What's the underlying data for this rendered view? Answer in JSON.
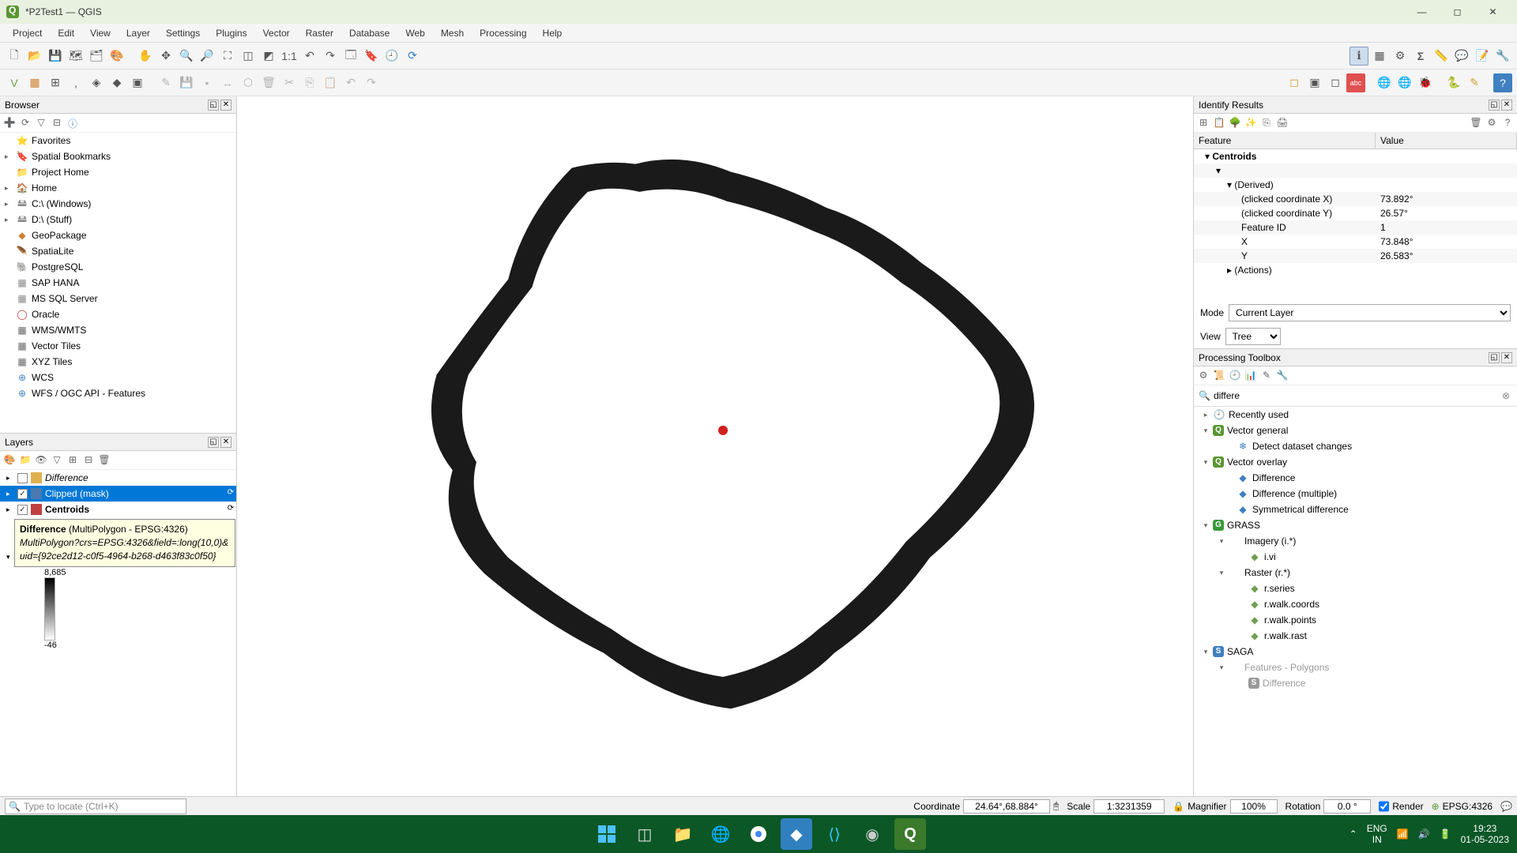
{
  "window": {
    "title": "*P2Test1 — QGIS"
  },
  "menu": [
    "Project",
    "Edit",
    "View",
    "Layer",
    "Settings",
    "Plugins",
    "Vector",
    "Raster",
    "Database",
    "Web",
    "Mesh",
    "Processing",
    "Help"
  ],
  "browser": {
    "title": "Browser",
    "items": [
      {
        "exp": "",
        "icon": "⭐",
        "label": "Favorites",
        "color": "#f0c040"
      },
      {
        "exp": "▸",
        "icon": "🔖",
        "label": "Spatial Bookmarks",
        "color": "#4080c0"
      },
      {
        "exp": "",
        "icon": "📁",
        "label": "Project Home",
        "color": "#888"
      },
      {
        "exp": "▸",
        "icon": "🏠",
        "label": "Home",
        "color": "#888"
      },
      {
        "exp": "▸",
        "icon": "🖴",
        "label": "C:\\ (Windows)",
        "color": "#888"
      },
      {
        "exp": "▸",
        "icon": "🖴",
        "label": "D:\\ (Stuff)",
        "color": "#888"
      },
      {
        "exp": "",
        "icon": "◆",
        "label": "GeoPackage",
        "color": "#d08030"
      },
      {
        "exp": "",
        "icon": "🪶",
        "label": "SpatiaLite",
        "color": "#4080c0"
      },
      {
        "exp": "",
        "icon": "🐘",
        "label": "PostgreSQL",
        "color": "#336791"
      },
      {
        "exp": "",
        "icon": "▦",
        "label": "SAP HANA",
        "color": "#888"
      },
      {
        "exp": "",
        "icon": "▦",
        "label": "MS SQL Server",
        "color": "#888"
      },
      {
        "exp": "",
        "icon": "◯",
        "label": "Oracle",
        "color": "#c04040"
      },
      {
        "exp": "",
        "icon": "▦",
        "label": "WMS/WMTS",
        "color": "#666"
      },
      {
        "exp": "",
        "icon": "▦",
        "label": "Vector Tiles",
        "color": "#666"
      },
      {
        "exp": "",
        "icon": "▦",
        "label": "XYZ Tiles",
        "color": "#666"
      },
      {
        "exp": "",
        "icon": "⊕",
        "label": "WCS",
        "color": "#4080c0"
      },
      {
        "exp": "",
        "icon": "⊕",
        "label": "WFS / OGC API - Features",
        "color": "#4080c0"
      }
    ]
  },
  "layers": {
    "title": "Layers",
    "rows": [
      {
        "checked": true,
        "swatch": "#c04040",
        "name": "Centroids",
        "bold": true,
        "italic": false,
        "selected": false,
        "ind": "⟳"
      },
      {
        "checked": true,
        "swatch": "#4a7ab0",
        "name": "Clipped (mask)",
        "bold": false,
        "italic": false,
        "selected": true,
        "ind": "⟳"
      },
      {
        "checked": false,
        "swatch": "#e0b050",
        "name": "Difference",
        "bold": false,
        "italic": true,
        "selected": false,
        "ind": ""
      }
    ],
    "gradient": {
      "max": "8,685",
      "min": "-46"
    },
    "tooltip_title": "Difference",
    "tooltip_crs": " (MultiPolygon - EPSG:4326)",
    "tooltip_body": "MultiPolygon?crs=EPSG:4326&field=:long(10,0)&uid={92ce2d12-c0f5-4964-b268-d463f83c0f50}"
  },
  "identify": {
    "title": "Identify Results",
    "header": [
      "Feature",
      "Value"
    ],
    "root": "Centroids",
    "derived_label": "(Derived)",
    "rows": [
      {
        "k": "(clicked coordinate X)",
        "v": "73.892°"
      },
      {
        "k": "(clicked coordinate Y)",
        "v": "26.57°"
      },
      {
        "k": "Feature ID",
        "v": "1"
      },
      {
        "k": "X",
        "v": "73.848°"
      },
      {
        "k": "Y",
        "v": "26.583°"
      }
    ],
    "actions_label": "(Actions)",
    "mode_label": "Mode",
    "mode_value": "Current Layer",
    "view_label": "View",
    "view_value": "Tree"
  },
  "toolbox": {
    "title": "Processing Toolbox",
    "search": "differe",
    "tree": [
      {
        "pad": 10,
        "exp": "▸",
        "icon": "🕘",
        "label": "Recently used",
        "color": "#888"
      },
      {
        "pad": 10,
        "exp": "▾",
        "icon": "Q",
        "label": "Vector general",
        "color": "#589632",
        "q": true
      },
      {
        "pad": 40,
        "exp": "",
        "icon": "❄",
        "label": "Detect dataset changes",
        "color": "#4080c0"
      },
      {
        "pad": 10,
        "exp": "▾",
        "icon": "Q",
        "label": "Vector overlay",
        "color": "#589632",
        "q": true
      },
      {
        "pad": 40,
        "exp": "",
        "icon": "◆",
        "label": "Difference",
        "color": "#4080c0"
      },
      {
        "pad": 40,
        "exp": "",
        "icon": "◆",
        "label": "Difference (multiple)",
        "color": "#4080c0"
      },
      {
        "pad": 40,
        "exp": "",
        "icon": "◆",
        "label": "Symmetrical difference",
        "color": "#4080c0"
      },
      {
        "pad": 10,
        "exp": "▾",
        "icon": "G",
        "label": "GRASS",
        "color": "#3a9a3a",
        "q": true
      },
      {
        "pad": 30,
        "exp": "▾",
        "icon": "",
        "label": "Imagery (i.*)",
        "color": ""
      },
      {
        "pad": 55,
        "exp": "",
        "icon": "◆",
        "label": "i.vi",
        "color": "#70a050"
      },
      {
        "pad": 30,
        "exp": "▾",
        "icon": "",
        "label": "Raster (r.*)",
        "color": ""
      },
      {
        "pad": 55,
        "exp": "",
        "icon": "◆",
        "label": "r.series",
        "color": "#70a050"
      },
      {
        "pad": 55,
        "exp": "",
        "icon": "◆",
        "label": "r.walk.coords",
        "color": "#70a050"
      },
      {
        "pad": 55,
        "exp": "",
        "icon": "◆",
        "label": "r.walk.points",
        "color": "#70a050"
      },
      {
        "pad": 55,
        "exp": "",
        "icon": "◆",
        "label": "r.walk.rast",
        "color": "#70a050"
      },
      {
        "pad": 10,
        "exp": "▾",
        "icon": "S",
        "label": "SAGA",
        "color": "#4080c0",
        "q": true
      },
      {
        "pad": 30,
        "exp": "▾",
        "icon": "",
        "label": "Features - Polygons",
        "color": "#999",
        "dim": true
      },
      {
        "pad": 55,
        "exp": "",
        "icon": "S",
        "label": "Difference",
        "color": "#999",
        "dim": true,
        "q": true
      }
    ]
  },
  "status": {
    "locate_placeholder": "Type to locate (Ctrl+K)",
    "coord_label": "Coordinate",
    "coord_value": "24.64°,68.884°",
    "scale_label": "Scale",
    "scale_value": "1:3231359",
    "mag_label": "Magnifier",
    "mag_value": "100%",
    "rot_label": "Rotation",
    "rot_value": "0.0 °",
    "render_label": "Render",
    "crs": "EPSG:4326"
  },
  "taskbar": {
    "lang1": "ENG",
    "lang2": "IN",
    "time": "19:23",
    "date": "01-05-2023"
  }
}
